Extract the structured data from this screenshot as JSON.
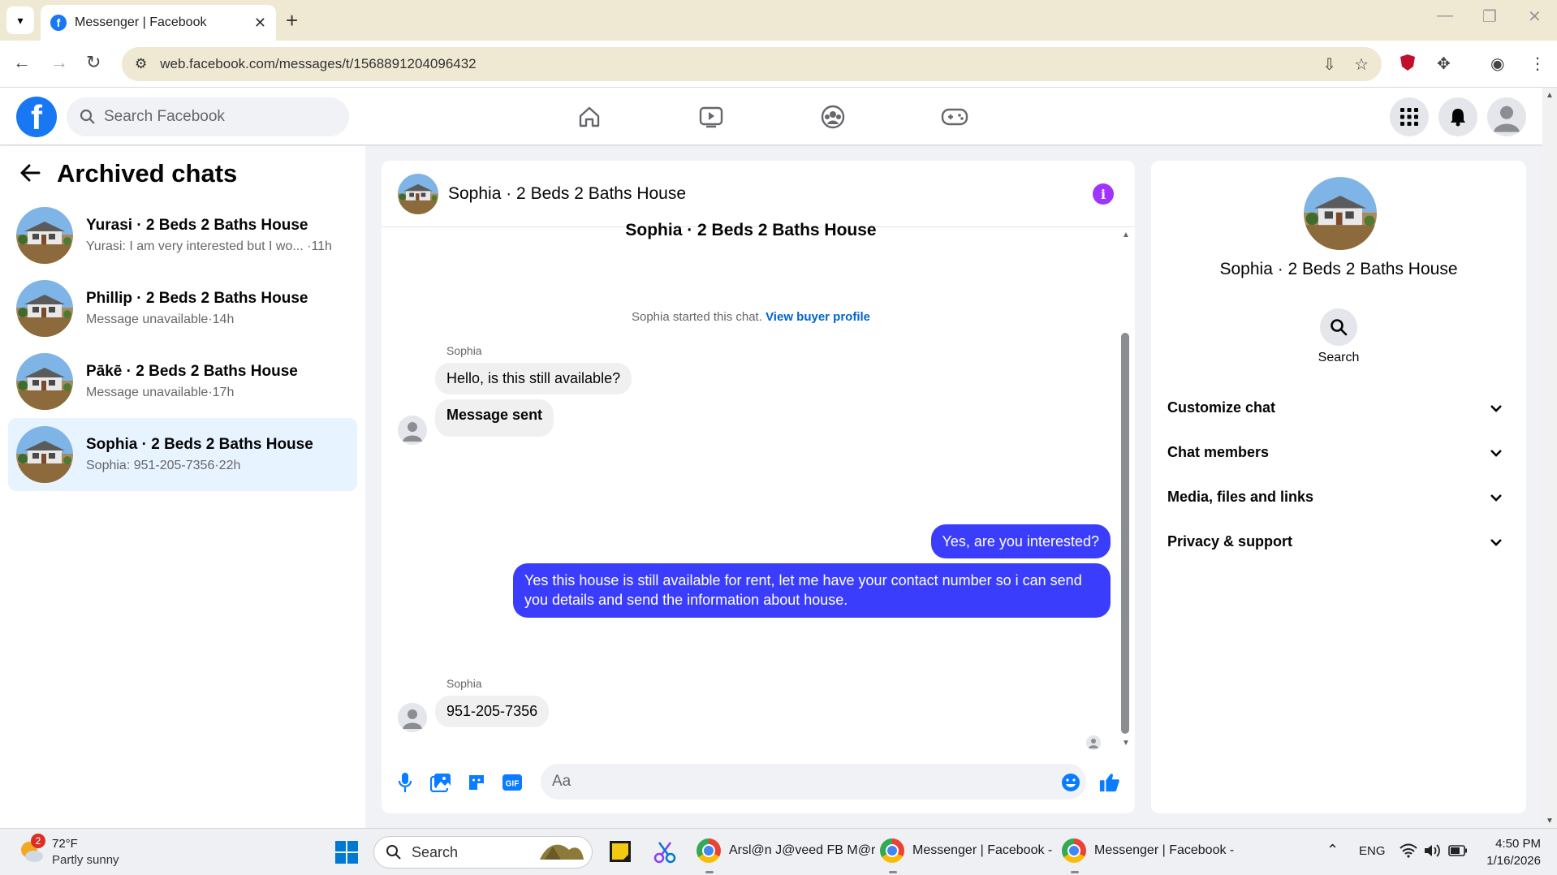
{
  "browser": {
    "tab_title": "Messenger | Facebook",
    "close_glyph": "✕",
    "new_tab_glyph": "+",
    "url": "web.facebook.com/messages/t/1568891204096432"
  },
  "fb": {
    "logo": "f",
    "search_placeholder": "Search Facebook"
  },
  "sidebar": {
    "title": "Archived chats",
    "chats": [
      {
        "name": "Yurasi · 2 Beds 2 Baths House",
        "preview": "Yurasi: I am very interested but I wo... ·11h",
        "active": false
      },
      {
        "name": "Phillip · 2 Beds 2 Baths House",
        "preview": "Message unavailable·14h",
        "active": false
      },
      {
        "name": "Pākē · 2 Beds 2 Baths House",
        "preview": "Message unavailable·17h",
        "active": false
      },
      {
        "name": "Sophia · 2 Beds 2 Baths House",
        "preview": "Sophia: 951-205-7356·22h",
        "active": true
      }
    ]
  },
  "conversation": {
    "header_name": "Sophia · 2 Beds 2 Baths House",
    "title": "Sophia · 2 Beds 2 Baths House",
    "started_text": "Sophia started this chat.",
    "buyer_link": "View buyer profile",
    "sender": "Sophia",
    "msg_in_1": "Hello, is this still available?",
    "msg_in_2": "Message sent",
    "msg_out_1": "Yes, are you interested?",
    "msg_out_2": "Yes this house is still available for rent, let me have your contact number so i can send you details and send the information about house.",
    "msg_in_3": "951-205-7356",
    "input_placeholder": "Aa"
  },
  "info_panel": {
    "name": "Sophia · 2 Beds 2 Baths House",
    "search_label": "Search",
    "sections": [
      "Customize chat",
      "Chat members",
      "Media, files and links",
      "Privacy & support"
    ]
  },
  "taskbar": {
    "weather_badge": "2",
    "temp": "72°F",
    "condition": "Partly sunny",
    "search": "Search",
    "app1": "Arsl@n J@veed FB M@r",
    "app2": "Messenger | Facebook -",
    "app3": "Messenger | Facebook -",
    "lang": "ENG",
    "time": "4:50 PM",
    "date": "1/16/2026"
  },
  "colors": {
    "facebook_blue": "#1877f2",
    "outgoing_bubble": "#3a3dfc",
    "active_chat_bg": "#e7f3ff",
    "info_purple": "#a033ff"
  }
}
